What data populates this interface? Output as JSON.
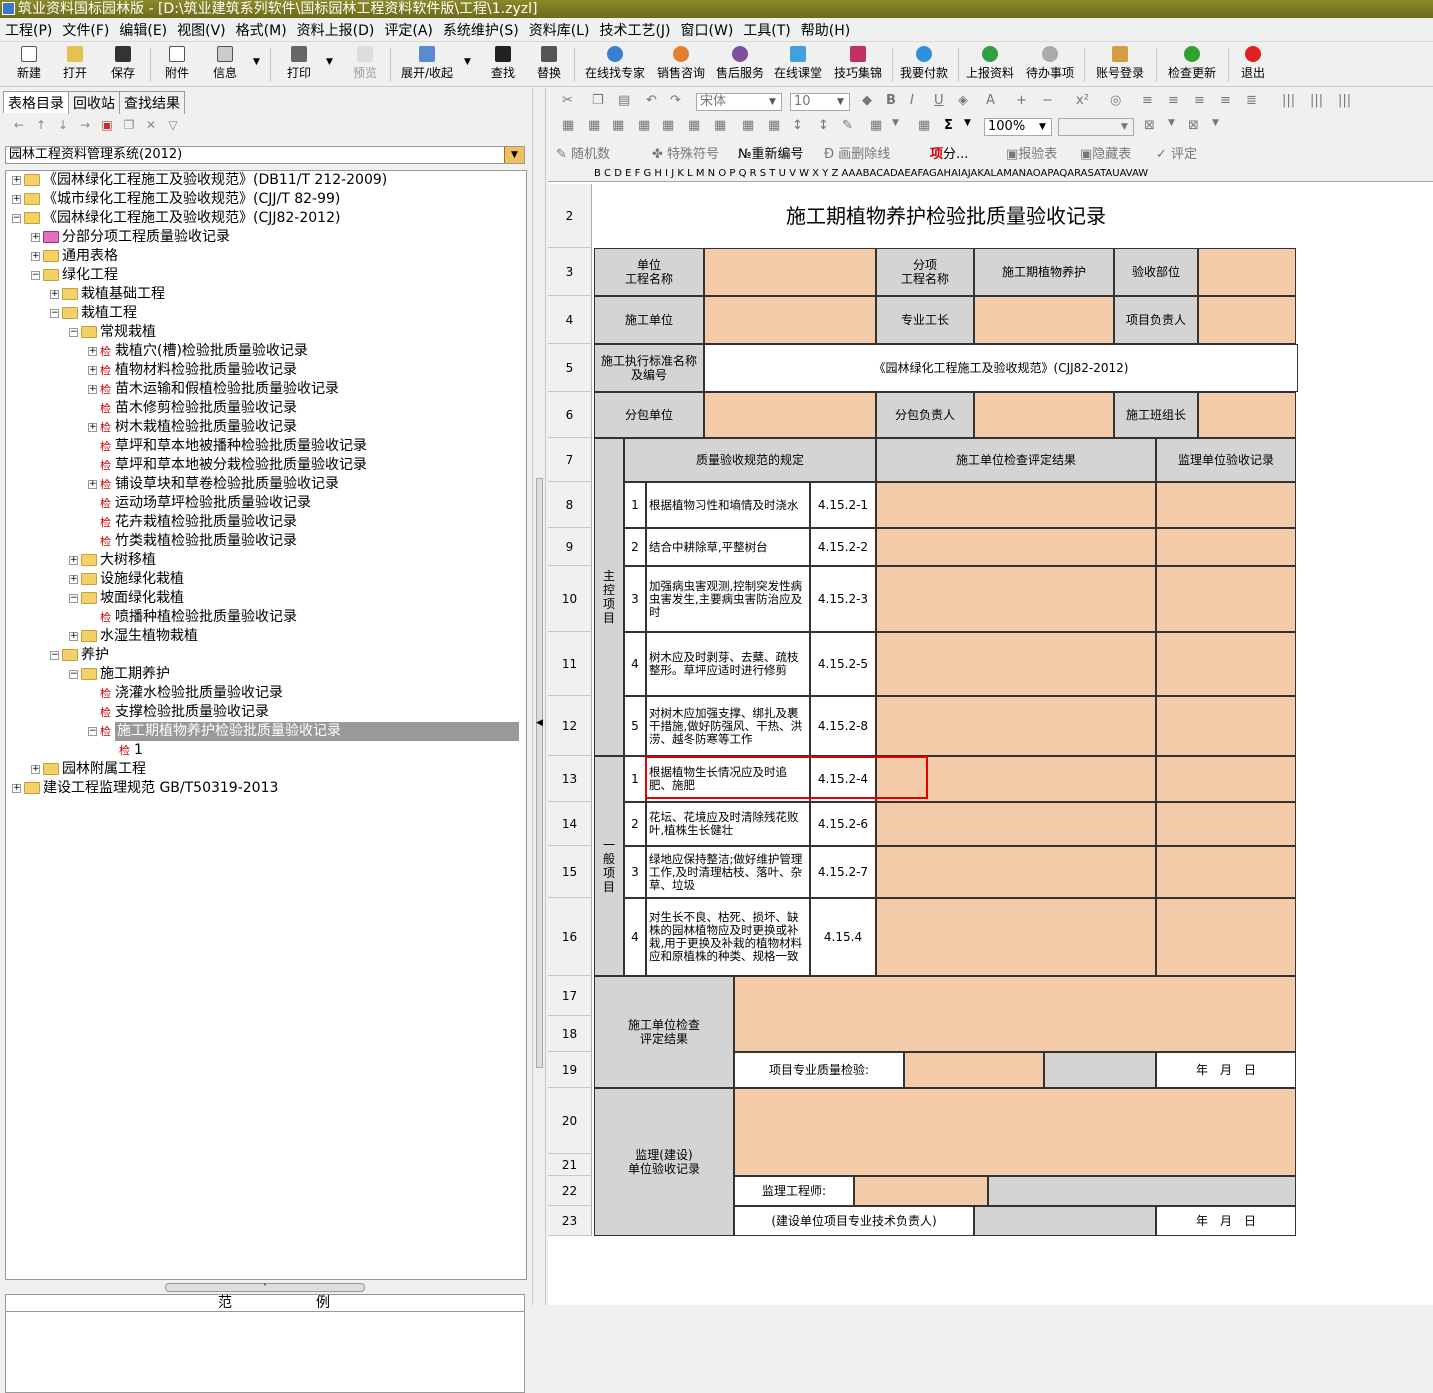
{
  "window": {
    "title": "筑业资料国标园林版 - [D:\\筑业建筑系列软件\\国标园林工程资料软件版\\工程\\1.zyzl]"
  },
  "menu": [
    "工程(P)",
    "文件(F)",
    "编辑(E)",
    "视图(V)",
    "格式(M)",
    "资料上报(D)",
    "评定(A)",
    "系统维护(S)",
    "资料库(L)",
    "技术工艺(J)",
    "窗口(W)",
    "工具(T)",
    "帮助(H)"
  ],
  "toolbar": {
    "new": "新建",
    "open": "打开",
    "save": "保存",
    "attach": "附件",
    "info": "信息",
    "print": "打印",
    "preview": "预览",
    "expand": "展开/收起",
    "find": "查找",
    "replace": "替换",
    "expert": "在线找专家",
    "sales": "销售咨询",
    "aftersales": "售后服务",
    "classroom": "在线课堂",
    "tips": "技巧集锦",
    "pay": "我要付款",
    "upload": "上报资料",
    "todo": "待办事项",
    "login": "账号登录",
    "update": "检查更新",
    "exit": "退出"
  },
  "left": {
    "tabs": [
      "表格目录",
      "回收站",
      "查找结果"
    ],
    "system": "园林工程资料管理系统(2012)",
    "legend": "范　　　　　　例"
  },
  "tree": [
    {
      "t": "《园林绿化工程施工及验收规范》(DB11/T 212-2009)",
      "lv": 0,
      "pm": "+",
      "ic": "fd"
    },
    {
      "t": "《城市绿化工程施工及验收规范》(CJJ/T 82-99)",
      "lv": 0,
      "pm": "+",
      "ic": "fd"
    },
    {
      "t": "《园林绿化工程施工及验收规范》(CJJ82-2012)",
      "lv": 0,
      "pm": "-",
      "ic": "fd"
    },
    {
      "t": "分部分项工程质量验收记录",
      "lv": 1,
      "pm": "+",
      "ic": "pk"
    },
    {
      "t": "通用表格",
      "lv": 1,
      "pm": "+",
      "ic": "fd"
    },
    {
      "t": "绿化工程",
      "lv": 1,
      "pm": "-",
      "ic": "fd"
    },
    {
      "t": "栽植基础工程",
      "lv": 2,
      "pm": "+",
      "ic": "fd"
    },
    {
      "t": "栽植工程",
      "lv": 2,
      "pm": "-",
      "ic": "fd"
    },
    {
      "t": "常规栽植",
      "lv": 3,
      "pm": "-",
      "ic": "fd"
    },
    {
      "t": "栽植穴(槽)检验批质量验收记录",
      "lv": 4,
      "pm": "+",
      "ic": "j"
    },
    {
      "t": "植物材料检验批质量验收记录",
      "lv": 4,
      "pm": "+",
      "ic": "j"
    },
    {
      "t": "苗木运输和假植检验批质量验收记录",
      "lv": 4,
      "pm": "+",
      "ic": "j"
    },
    {
      "t": "苗木修剪检验批质量验收记录",
      "lv": 4,
      "pm": "",
      "ic": "j"
    },
    {
      "t": "树木栽植检验批质量验收记录",
      "lv": 4,
      "pm": "+",
      "ic": "j"
    },
    {
      "t": "草坪和草本地被播种检验批质量验收记录",
      "lv": 4,
      "pm": "",
      "ic": "j"
    },
    {
      "t": "草坪和草本地被分栽检验批质量验收记录",
      "lv": 4,
      "pm": "",
      "ic": "j"
    },
    {
      "t": "铺设草块和草卷检验批质量验收记录",
      "lv": 4,
      "pm": "+",
      "ic": "j"
    },
    {
      "t": "运动场草坪检验批质量验收记录",
      "lv": 4,
      "pm": "",
      "ic": "j"
    },
    {
      "t": "花卉栽植检验批质量验收记录",
      "lv": 4,
      "pm": "",
      "ic": "j"
    },
    {
      "t": "竹类栽植检验批质量验收记录",
      "lv": 4,
      "pm": "",
      "ic": "j"
    },
    {
      "t": "大树移植",
      "lv": 3,
      "pm": "+",
      "ic": "fd"
    },
    {
      "t": "设施绿化栽植",
      "lv": 3,
      "pm": "+",
      "ic": "fd"
    },
    {
      "t": "坡面绿化栽植",
      "lv": 3,
      "pm": "-",
      "ic": "fd"
    },
    {
      "t": "喷播种植检验批质量验收记录",
      "lv": 4,
      "pm": "",
      "ic": "j"
    },
    {
      "t": "水湿生植物栽植",
      "lv": 3,
      "pm": "+",
      "ic": "fd"
    },
    {
      "t": "养护",
      "lv": 2,
      "pm": "-",
      "ic": "fd"
    },
    {
      "t": "施工期养护",
      "lv": 3,
      "pm": "-",
      "ic": "fd"
    },
    {
      "t": "浇灌水检验批质量验收记录",
      "lv": 4,
      "pm": "",
      "ic": "j"
    },
    {
      "t": "支撑检验批质量验收记录",
      "lv": 4,
      "pm": "",
      "ic": "j"
    },
    {
      "t": "施工期植物养护检验批质量验收记录",
      "lv": 4,
      "pm": "-",
      "ic": "j",
      "sel": true
    },
    {
      "t": "1",
      "lv": 5,
      "pm": "",
      "ic": "j"
    },
    {
      "t": "园林附属工程",
      "lv": 1,
      "pm": "+",
      "ic": "fd"
    },
    {
      "t": "建设工程监理规范 GB/T50319-2013",
      "lv": 0,
      "pm": "+",
      "ic": "fd"
    }
  ],
  "rtools": {
    "font": "宋体",
    "size": "10",
    "zoom": "100%",
    "row3": [
      "随机数",
      "特殊符号",
      "重新编号",
      "画删除线",
      "分...",
      "报验表",
      "隐藏表",
      "评定"
    ],
    "sigma": "Σ"
  },
  "colhdr": "B C D E F G H I J K L M N O P Q R S T U V W X Y Z AAABACADAEAFAGAHAIAJAKALAMANAOAPAQARASATAUAVAW",
  "form": {
    "title": "施工期植物养护检验批质量验收记录",
    "r3": [
      "单位\n工程名称",
      "分项\n工程名称",
      "施工期植物养护",
      "验收部位"
    ],
    "r4": [
      "施工单位",
      "专业工长",
      "项目负责人"
    ],
    "r5": [
      "施工执行标准名称\n及编号",
      "《园林绿化工程施工及验收规范》(CJJ82-2012)"
    ],
    "r6": [
      "分包单位",
      "分包负责人",
      "施工班组长"
    ],
    "r7": [
      "质量验收规范的规定",
      "施工单位检查评定结果",
      "监理单位验收记录"
    ],
    "main_label": "主\n控\n项\n目",
    "general_label": "一\n般\n项\n目",
    "items": [
      {
        "n": "1",
        "d": "根据植物习性和墒情及时浇水",
        "c": "4.15.2-1"
      },
      {
        "n": "2",
        "d": "结合中耕除草,平整树台",
        "c": "4.15.2-2"
      },
      {
        "n": "3",
        "d": "加强病虫害观测,控制突发性病虫害发生,主要病虫害防治应及时",
        "c": "4.15.2-3"
      },
      {
        "n": "4",
        "d": "树木应及时剥芽、去蘖、疏枝整形。草坪应适时进行修剪",
        "c": "4.15.2-5"
      },
      {
        "n": "5",
        "d": "对树木应加强支撑、绑扎及裹干措施,做好防强风、干热、洪涝、越冬防寒等工作",
        "c": "4.15.2-8"
      },
      {
        "n": "1",
        "d": "根据植物生长情况应及时追肥、施肥",
        "c": "4.15.2-4"
      },
      {
        "n": "2",
        "d": "花坛、花境应及时清除残花败叶,植株生长健壮",
        "c": "4.15.2-6"
      },
      {
        "n": "3",
        "d": "绿地应保持整洁;做好维护管理工作,及时清理枯枝、落叶、杂草、垃圾",
        "c": "4.15.2-7"
      },
      {
        "n": "4",
        "d": "对生长不良、枯死、损坏、缺株的园林植物应及时更换或补栽,用于更换及补栽的植物材料应和原植株的种类、规格一致",
        "c": "4.15.4"
      }
    ],
    "check_result": "施工单位检查\n评定结果",
    "quality_inspector": "项目专业质量检验:",
    "date": "年　月　日",
    "supervision": "监理(建设)\n单位验收记录",
    "engineer": "监理工程师:",
    "owner_note": "(建设单位项目专业技术负责人)"
  },
  "rows": [
    "2",
    "3",
    "4",
    "5",
    "6",
    "7",
    "8",
    "9",
    "10",
    "11",
    "12",
    "13",
    "14",
    "15",
    "16",
    "17",
    "18",
    "19",
    "20",
    "21",
    "22",
    "23"
  ]
}
